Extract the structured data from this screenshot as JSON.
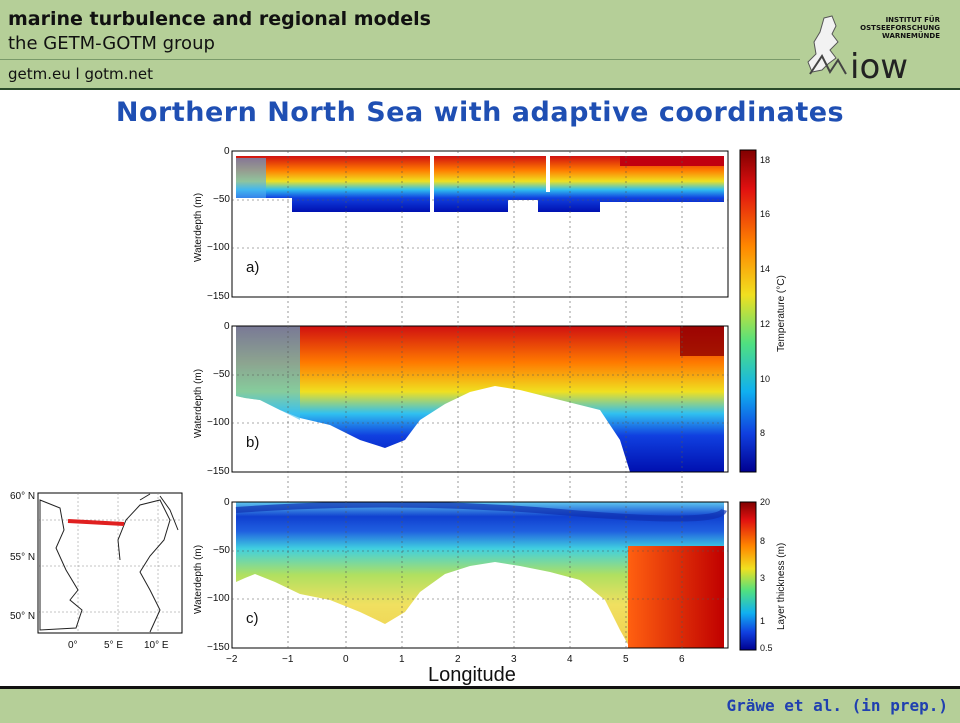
{
  "header": {
    "line1": "marine turbulence and regional models",
    "line2": "the GETM-GOTM group",
    "links": "getm.eu  l  gotm.net",
    "logo_text_1": "INSTITUT FÜR",
    "logo_text_2": "OSTSEEFORSCHUNG",
    "logo_text_3": "WARNEMÜNDE",
    "logo_word": "iow"
  },
  "slide": {
    "title": "Northern North Sea with adaptive coordinates",
    "footer": "Gräwe et al. (in prep.)"
  },
  "figure": {
    "y_ticks": [
      "0",
      "−50",
      "−100",
      "−150"
    ],
    "x_ticks": [
      "−2",
      "−1",
      "0",
      "1",
      "2",
      "3",
      "4",
      "5",
      "6"
    ],
    "xlabel": "Longitude",
    "ylabel": "Waterdepth (m)",
    "panels": [
      "a)",
      "b)",
      "c)"
    ],
    "cb1_ticks": [
      "18",
      "16",
      "14",
      "12",
      "10",
      "8"
    ],
    "cb1_title": "Temperature (°C)",
    "cb2_ticks": [
      "20",
      "8",
      "3",
      "1",
      "0.5"
    ],
    "cb2_title": "Layer thickness (m)"
  },
  "map": {
    "lat_labels": [
      "60° N",
      "55° N",
      "50° N"
    ],
    "lon_labels": [
      "0°",
      "5° E",
      "10° E"
    ]
  },
  "colors": {
    "header_bg": "#b5cf98",
    "title": "#1f4fb3",
    "footer_text": "#2040b0",
    "section_line": "#e02020"
  }
}
